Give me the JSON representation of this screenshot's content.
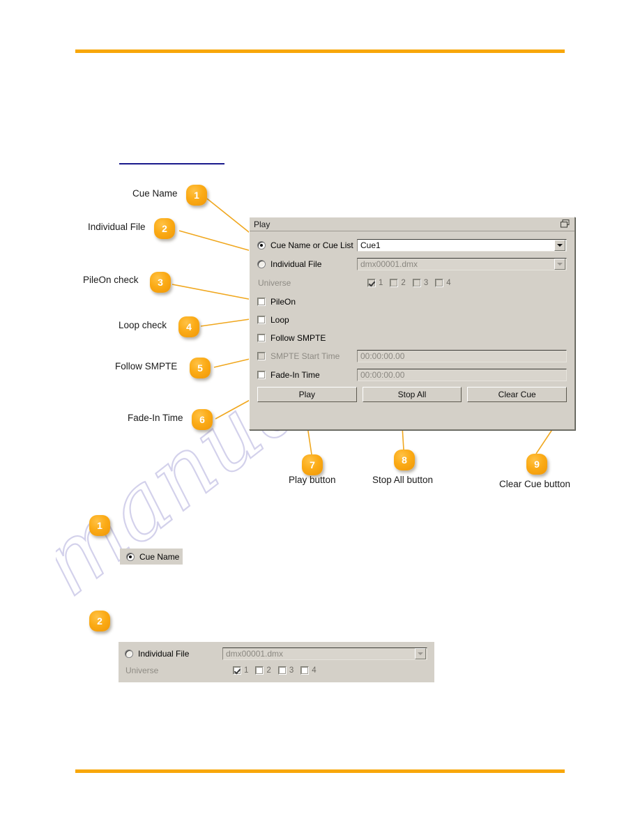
{
  "page": {
    "accent_orange": "#f8a70a",
    "blue_rule": "#1a1a8c",
    "watermark_text": "manualshive.com"
  },
  "dialog": {
    "title": "Play",
    "restore_icon": "restore-window-icon",
    "rows": {
      "cue_name": {
        "label": "Cue Name or Cue List",
        "radio_selected": true,
        "value": "Cue1"
      },
      "individual_file": {
        "label": "Individual File",
        "radio_selected": false,
        "value": "dmx00001.dmx"
      },
      "universe": {
        "label": "Universe",
        "items": [
          {
            "n": "1",
            "checked": true
          },
          {
            "n": "2",
            "checked": false
          },
          {
            "n": "3",
            "checked": false
          },
          {
            "n": "4",
            "checked": false
          }
        ]
      },
      "pileon": {
        "label": "PileOn",
        "checked": false
      },
      "loop": {
        "label": "Loop",
        "checked": false
      },
      "follow_smpte": {
        "label": "Follow SMPTE",
        "checked": false
      },
      "smpte_start_time": {
        "label": "SMPTE Start Time",
        "checked": false,
        "value": "00:00:00.00"
      },
      "fade_in_time": {
        "label": "Fade-In Time",
        "checked": false,
        "value": "00:00:00.00"
      }
    },
    "buttons": {
      "play": "Play",
      "stop_all": "Stop All",
      "clear_cue": "Clear Cue"
    }
  },
  "callouts": [
    {
      "num": "1",
      "label": "Cue Name"
    },
    {
      "num": "2",
      "label": "Individual File"
    },
    {
      "num": "3",
      "label": "PileOn check"
    },
    {
      "num": "4",
      "label": "Loop check"
    },
    {
      "num": "5",
      "label": "Follow SMPTE"
    },
    {
      "num": "6",
      "label": "Fade-In Time"
    },
    {
      "num": "7",
      "label": "Play button"
    },
    {
      "num": "8",
      "label": "Stop All button"
    },
    {
      "num": "9",
      "label": "Clear Cue button"
    }
  ],
  "details": {
    "section_1": {
      "num": "1",
      "radio_label": "Cue Name",
      "radio_selected": true
    },
    "section_2": {
      "num": "2",
      "radio_label": "Individual File",
      "radio_selected": false,
      "file_value": "dmx00001.dmx",
      "universe_label": "Universe",
      "universe_items": [
        {
          "n": "1",
          "checked": true
        },
        {
          "n": "2",
          "checked": false
        },
        {
          "n": "3",
          "checked": false
        },
        {
          "n": "4",
          "checked": false
        }
      ]
    }
  }
}
